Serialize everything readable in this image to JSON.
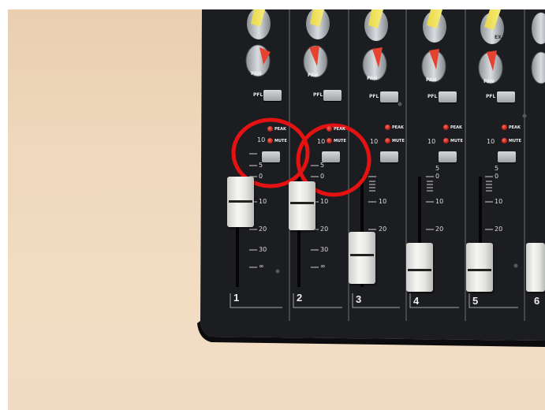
{
  "channels": [
    {
      "number": "1"
    },
    {
      "number": "2"
    },
    {
      "number": "3"
    },
    {
      "number": "4"
    },
    {
      "number": "5"
    },
    {
      "number": "6"
    }
  ],
  "labels": {
    "pan": "PAN",
    "pfl": "PFL",
    "peak": "PEAK",
    "mute": "MUTE",
    "eq_label": "EX"
  },
  "scale": {
    "ten": "10",
    "five": "5",
    "zero": "0",
    "twenty": "20",
    "thirty": "30",
    "infinity": "∞"
  },
  "highlight_color": "#e41212"
}
